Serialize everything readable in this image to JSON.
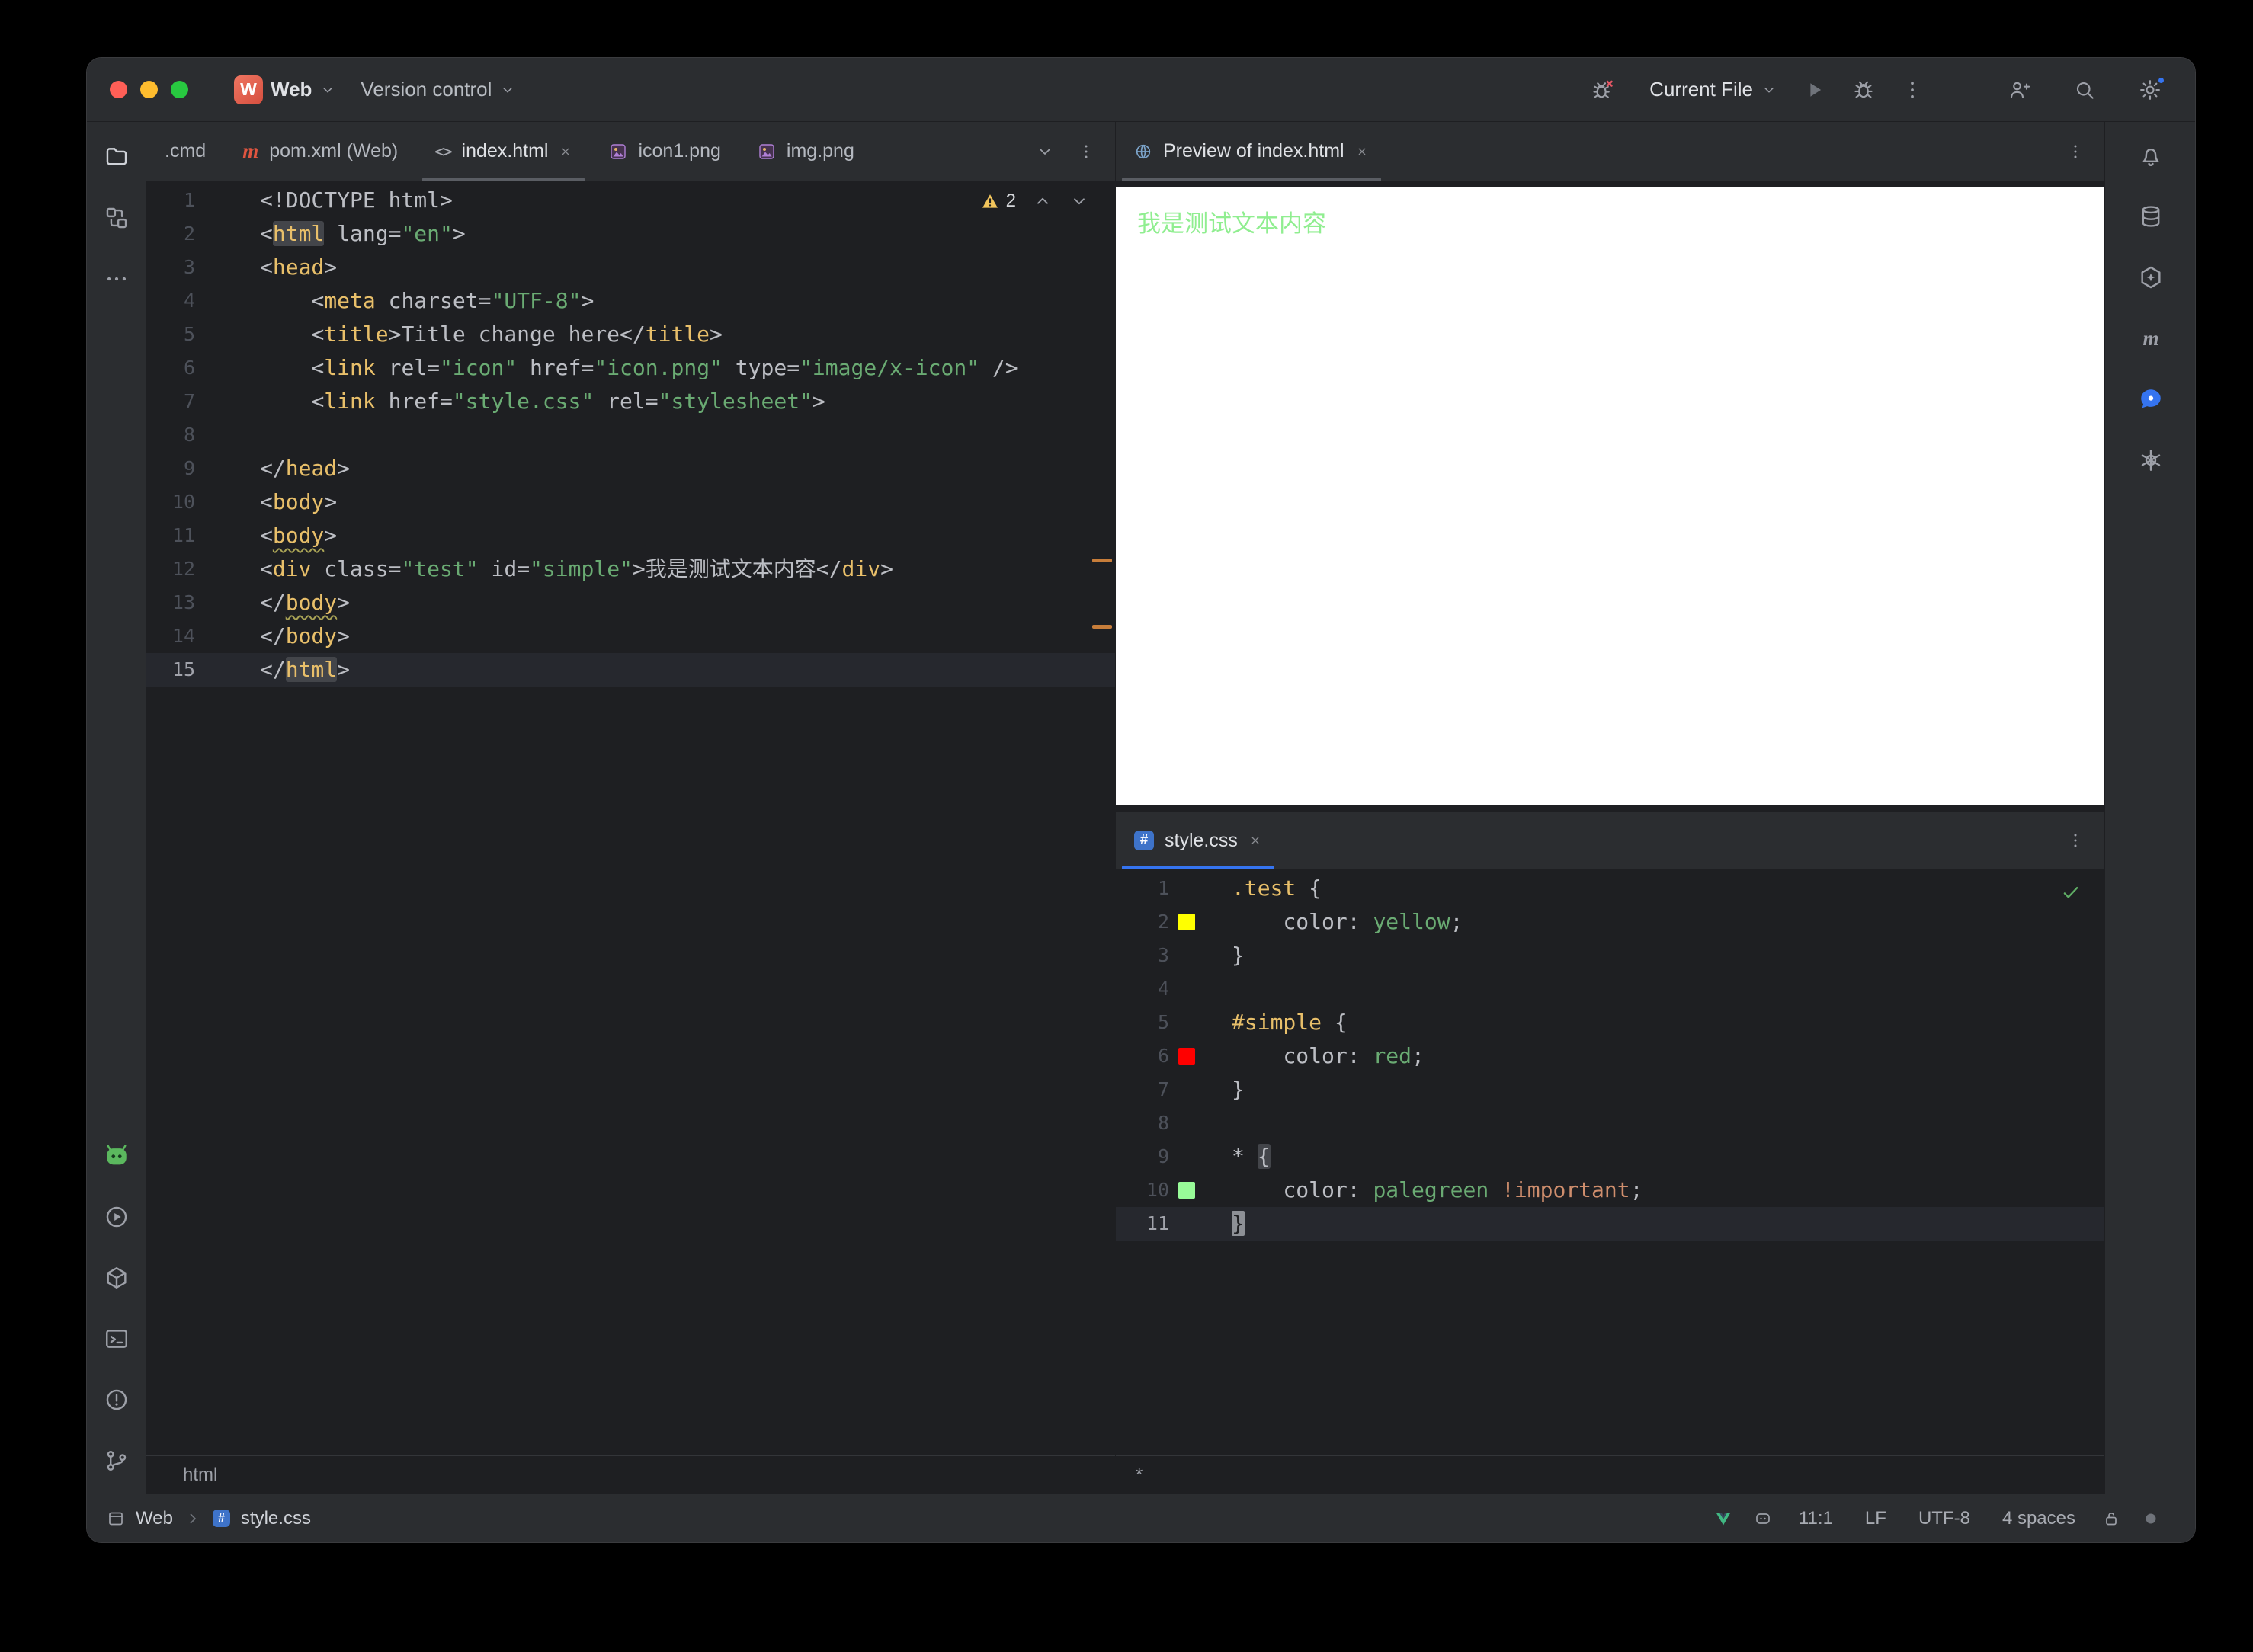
{
  "titlebar": {
    "project_initial": "W",
    "project": "Web",
    "vcs": "Version control",
    "run_config": "Current File"
  },
  "left_tabs": [
    {
      "label": ".cmd",
      "icon": "",
      "active": false,
      "closable": false
    },
    {
      "label": "pom.xml (Web)",
      "icon": "maven",
      "active": false,
      "closable": false
    },
    {
      "label": "index.html",
      "icon": "html-file",
      "active": true,
      "closable": true
    },
    {
      "label": "icon1.png",
      "icon": "image-file",
      "active": false,
      "closable": false
    },
    {
      "label": "img.png",
      "icon": "image-file",
      "active": false,
      "closable": false
    }
  ],
  "left_strip": [
    "project-folder",
    "structure",
    "more"
  ],
  "left_strip_bottom": [
    "kodee-plugin",
    "services-run",
    "build",
    "terminal",
    "problems",
    "version-control"
  ],
  "right_strip": [
    "notifications-bell",
    "database",
    "ai-assistant",
    "maven",
    "ai-chat",
    "openai"
  ],
  "editor_html": {
    "warning_count": "2",
    "breadcrumb": "html",
    "lines": [
      {
        "n": "1",
        "segs": [
          [
            "<!DOCTYPE html>",
            "p"
          ]
        ]
      },
      {
        "n": "2",
        "segs": [
          [
            "<",
            "p"
          ],
          [
            "html",
            "th"
          ],
          [
            " ",
            "p"
          ],
          [
            "lang",
            "p"
          ],
          [
            "=",
            "p"
          ],
          [
            "\"en\"",
            "s"
          ],
          [
            ">",
            "p"
          ]
        ]
      },
      {
        "n": "3",
        "segs": [
          [
            "<",
            "p"
          ],
          [
            "head",
            "t"
          ],
          [
            ">",
            "p"
          ]
        ]
      },
      {
        "n": "4",
        "segs": [
          [
            "    ",
            "p"
          ],
          [
            "<",
            "p"
          ],
          [
            "meta",
            "t"
          ],
          [
            " ",
            "p"
          ],
          [
            "charset",
            "p"
          ],
          [
            "=",
            "p"
          ],
          [
            "\"UTF-8\"",
            "s"
          ],
          [
            ">",
            "p"
          ]
        ]
      },
      {
        "n": "5",
        "segs": [
          [
            "    ",
            "p"
          ],
          [
            "<",
            "p"
          ],
          [
            "title",
            "t"
          ],
          [
            ">",
            "p"
          ],
          [
            "Title change here",
            "p"
          ],
          [
            "</",
            "p"
          ],
          [
            "title",
            "t"
          ],
          [
            ">",
            "p"
          ]
        ]
      },
      {
        "n": "6",
        "segs": [
          [
            "    ",
            "p"
          ],
          [
            "<",
            "p"
          ],
          [
            "link",
            "t"
          ],
          [
            " ",
            "p"
          ],
          [
            "rel",
            "p"
          ],
          [
            "=",
            "p"
          ],
          [
            "\"icon\"",
            "s"
          ],
          [
            " ",
            "p"
          ],
          [
            "href",
            "p"
          ],
          [
            "=",
            "p"
          ],
          [
            "\"icon.png\"",
            "s"
          ],
          [
            " ",
            "p"
          ],
          [
            "type",
            "p"
          ],
          [
            "=",
            "p"
          ],
          [
            "\"image/x-icon\"",
            "s"
          ],
          [
            " />",
            "p"
          ]
        ]
      },
      {
        "n": "7",
        "segs": [
          [
            "    ",
            "p"
          ],
          [
            "<",
            "p"
          ],
          [
            "link",
            "t"
          ],
          [
            " ",
            "p"
          ],
          [
            "href",
            "p"
          ],
          [
            "=",
            "p"
          ],
          [
            "\"style.css\"",
            "s"
          ],
          [
            " ",
            "p"
          ],
          [
            "rel",
            "p"
          ],
          [
            "=",
            "p"
          ],
          [
            "\"stylesheet\"",
            "s"
          ],
          [
            ">",
            "p"
          ]
        ]
      },
      {
        "n": "8",
        "segs": []
      },
      {
        "n": "9",
        "segs": [
          [
            "</",
            "p"
          ],
          [
            "head",
            "t"
          ],
          [
            ">",
            "p"
          ]
        ]
      },
      {
        "n": "10",
        "segs": [
          [
            "<",
            "p"
          ],
          [
            "body",
            "t"
          ],
          [
            ">",
            "p"
          ]
        ]
      },
      {
        "n": "11",
        "segs": [
          [
            "<",
            "p"
          ],
          [
            "body",
            "tw"
          ],
          [
            ">",
            "p"
          ]
        ]
      },
      {
        "n": "12",
        "segs": [
          [
            "<",
            "p"
          ],
          [
            "div",
            "t"
          ],
          [
            " ",
            "p"
          ],
          [
            "class",
            "p"
          ],
          [
            "=",
            "p"
          ],
          [
            "\"test\"",
            "s"
          ],
          [
            " ",
            "p"
          ],
          [
            "id",
            "p"
          ],
          [
            "=",
            "p"
          ],
          [
            "\"simple\"",
            "s"
          ],
          [
            ">",
            "p"
          ],
          [
            "我是测试文本内容",
            "p"
          ],
          [
            "</",
            "p"
          ],
          [
            "div",
            "t"
          ],
          [
            ">",
            "p"
          ]
        ]
      },
      {
        "n": "13",
        "segs": [
          [
            "</",
            "p"
          ],
          [
            "body",
            "tw"
          ],
          [
            ">",
            "p"
          ]
        ]
      },
      {
        "n": "14",
        "segs": [
          [
            "</",
            "p"
          ],
          [
            "body",
            "t"
          ],
          [
            ">",
            "p"
          ]
        ]
      },
      {
        "n": "15",
        "active": true,
        "segs": [
          [
            "</",
            "p"
          ],
          [
            "html",
            "th"
          ],
          [
            ">",
            "p"
          ]
        ]
      }
    ]
  },
  "preview": {
    "tab_label": "Preview of index.html",
    "content": "我是测试文本内容",
    "text_color": "#90ee90"
  },
  "editor_css": {
    "tab_label": "style.css",
    "breadcrumb": "*",
    "lines": [
      {
        "n": "1",
        "segs": [
          [
            ".test",
            "sel"
          ],
          [
            " {",
            "p"
          ]
        ]
      },
      {
        "n": "2",
        "swatch": "#ffff00",
        "segs": [
          [
            "    ",
            "p"
          ],
          [
            "color",
            "prop"
          ],
          [
            ": ",
            "p"
          ],
          [
            "yellow",
            "val"
          ],
          [
            ";",
            "p"
          ]
        ]
      },
      {
        "n": "3",
        "segs": [
          [
            "}",
            "p"
          ]
        ]
      },
      {
        "n": "4",
        "segs": []
      },
      {
        "n": "5",
        "segs": [
          [
            "#simple",
            "sel"
          ],
          [
            " {",
            "p"
          ]
        ]
      },
      {
        "n": "6",
        "swatch": "#ff0000",
        "segs": [
          [
            "    ",
            "p"
          ],
          [
            "color",
            "prop"
          ],
          [
            ": ",
            "p"
          ],
          [
            "red",
            "val"
          ],
          [
            ";",
            "p"
          ]
        ]
      },
      {
        "n": "7",
        "segs": [
          [
            "}",
            "p"
          ]
        ]
      },
      {
        "n": "8",
        "segs": []
      },
      {
        "n": "9",
        "segs": [
          [
            "*",
            "p"
          ],
          [
            " ",
            "p"
          ],
          [
            "{",
            "bh"
          ]
        ]
      },
      {
        "n": "10",
        "swatch": "#98fb98",
        "segs": [
          [
            "    ",
            "p"
          ],
          [
            "color",
            "prop"
          ],
          [
            ": ",
            "p"
          ],
          [
            "palegreen",
            "val"
          ],
          [
            " ",
            "p"
          ],
          [
            "!important",
            "imp"
          ],
          [
            ";",
            "p"
          ]
        ]
      },
      {
        "n": "11",
        "active": true,
        "segs": [
          [
            "}",
            "cur"
          ]
        ]
      }
    ]
  },
  "statusbar": {
    "project": "Web",
    "file": "style.css",
    "caret": "11:1",
    "line_ending": "LF",
    "encoding": "UTF-8",
    "indent": "4 spaces"
  },
  "colors": {
    "accent": "#3574f0",
    "warning_badge": "#f2c55c",
    "preview_text": "#90ee90",
    "editor_bg": "#1e1f22",
    "chrome_bg": "#2b2d30"
  }
}
